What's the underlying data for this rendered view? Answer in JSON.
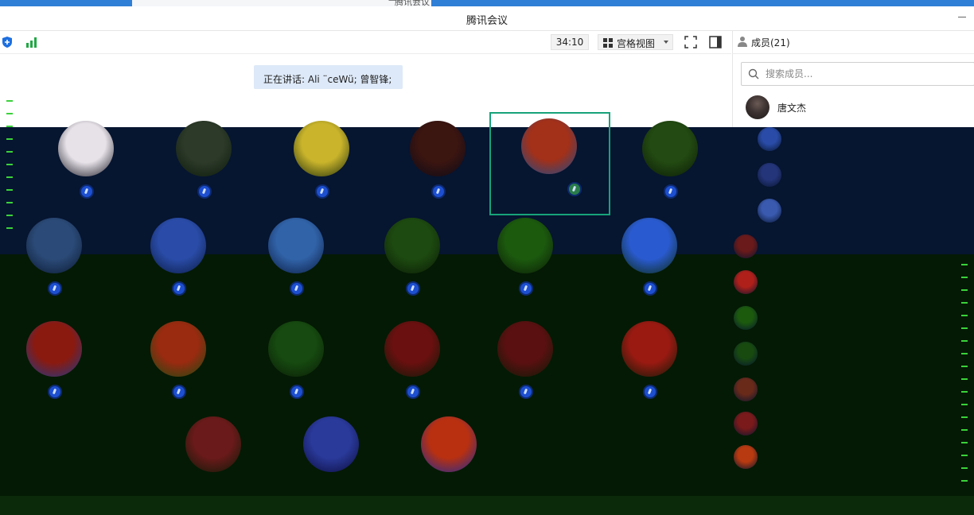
{
  "os": {
    "ghost_title": "腾讯会议"
  },
  "window": {
    "title": "腾讯会议"
  },
  "toolbar": {
    "shield_icon": "shield-icon",
    "signal_icon": "signal-bars-icon",
    "timer": "34:10",
    "view_mode_label": "宫格视图",
    "fullscreen_icon": "fullscreen-icon",
    "side_panel_icon": "side-panel-icon"
  },
  "main": {
    "speaking": "正在讲话: Ali  ¨ceWü; 曾智锋;",
    "tiles": [
      {
        "colors": [
          "#e7e2e8",
          "#14131f"
        ]
      },
      {
        "colors": [
          "#2d3a2a",
          "#0b1a0b"
        ]
      },
      {
        "colors": [
          "#c9b42b",
          "#1b2a0a"
        ]
      },
      {
        "colors": [
          "#3b1510",
          "#0a0a18"
        ]
      },
      {
        "colors": [
          "#a33018",
          "#1a4a8a"
        ]
      },
      {
        "colors": [
          "#234a12",
          "#0a1a06"
        ]
      },
      {
        "colors": [
          "#2b4a77",
          "#0a1830"
        ]
      },
      {
        "colors": [
          "#2a4ca8",
          "#0a1a40"
        ]
      },
      {
        "colors": [
          "#3163a8",
          "#0a1a40"
        ]
      },
      {
        "colors": [
          "#1d4a10",
          "#0a1a06"
        ]
      },
      {
        "colors": [
          "#1c5a0e",
          "#0a1a06"
        ]
      },
      {
        "colors": [
          "#2a5ad0",
          "#0a2a0a"
        ]
      },
      {
        "colors": [
          "#8a1a10",
          "#1a3a8a"
        ]
      },
      {
        "colors": [
          "#9a2a10",
          "#1a4a10"
        ]
      },
      {
        "colors": [
          "#164a10",
          "#0a1a06"
        ]
      },
      {
        "colors": [
          "#6a1010",
          "#0a1a06"
        ]
      },
      {
        "colors": [
          "#5a1010",
          "#0a1a06"
        ]
      },
      {
        "colors": [
          "#9a1a12",
          "#0a1a06"
        ]
      },
      {
        "colors": [
          "#6a1a1a",
          "#0a1a06"
        ]
      },
      {
        "colors": [
          "#2a3a9a",
          "#0a0a3a"
        ]
      },
      {
        "colors": [
          "#b83010",
          "#1a2a9a"
        ]
      }
    ]
  },
  "members": {
    "header_label": "成员(21)",
    "search_placeholder": "搜索成员...",
    "first_member_name": "唐文杰"
  },
  "colors": {
    "accent_blue": "#1d4fd0",
    "active_border": "#17a37a",
    "speaker_bg": "#dde9f8"
  }
}
